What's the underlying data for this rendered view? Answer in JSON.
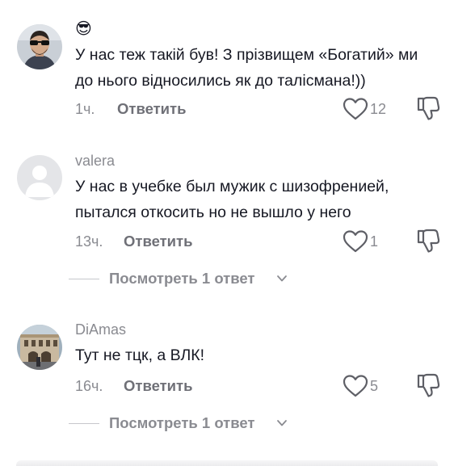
{
  "comments": [
    {
      "emoji": "😎",
      "username": "",
      "text": "У нас теж такій був! З прізвищем «Богатий» ми\nдо нього відносились як до талісмана!))",
      "time": "1ч.",
      "reply_label": "Ответить",
      "like_count": "12",
      "avatar": "man-sunglasses-photo"
    },
    {
      "username": "valera",
      "text": "У нас в учебке был мужик с шизофренией,\nпытался откосить но не вышло у него",
      "time": "13ч.",
      "reply_label": "Ответить",
      "like_count": "1",
      "avatar": "default-gray-avatar",
      "view_replies": "Посмотреть 1 ответ"
    },
    {
      "username": "DiAmas",
      "text": "Тут не тцк, а ВЛК!",
      "time": "16ч.",
      "reply_label": "Ответить",
      "like_count": "5",
      "avatar": "building-photo",
      "view_replies": "Посмотреть 1 ответ"
    }
  ],
  "icons": {
    "like": "heart-outline-icon",
    "dislike": "thumbs-down-outline-icon",
    "expand": "chevron-down-icon"
  },
  "colors": {
    "text": "#161823",
    "muted": "#8a8b91",
    "reply": "#6f7077",
    "icon": "#5e5f66"
  }
}
